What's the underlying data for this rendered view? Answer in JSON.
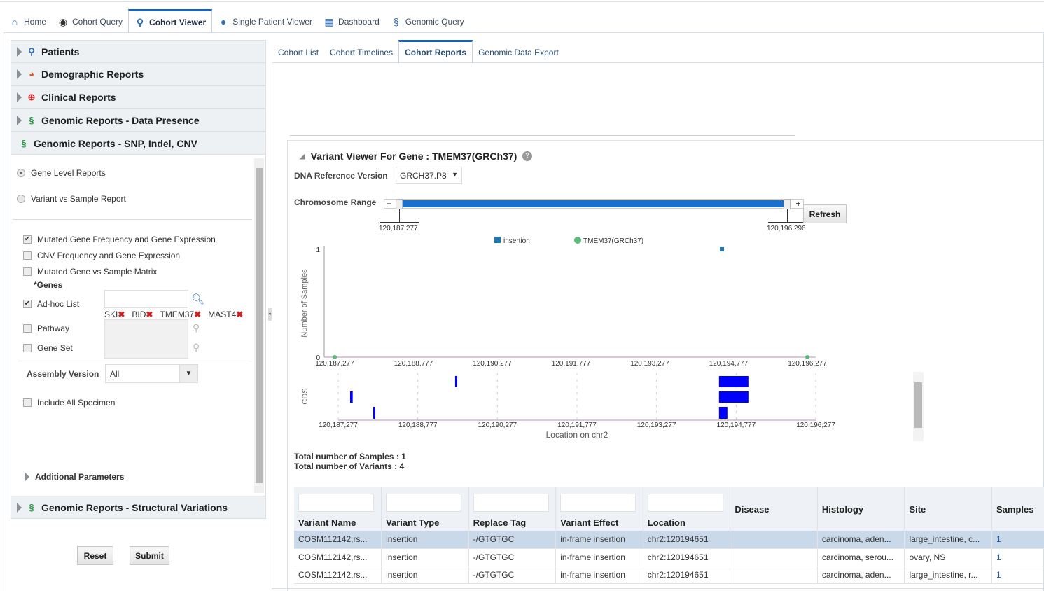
{
  "main_tabs": [
    {
      "label": "Home",
      "icon": "home-icon"
    },
    {
      "label": "Cohort Query",
      "icon": "cohort-query-icon"
    },
    {
      "label": "Cohort Viewer",
      "icon": "cohort-viewer-icon",
      "active": true
    },
    {
      "label": "Single Patient Viewer",
      "icon": "patient-icon"
    },
    {
      "label": "Dashboard",
      "icon": "dashboard-icon"
    },
    {
      "label": "Genomic Query",
      "icon": "genomic-query-icon"
    }
  ],
  "sidebar": {
    "sections": [
      {
        "label": "Patients"
      },
      {
        "label": "Demographic Reports"
      },
      {
        "label": "Clinical Reports"
      },
      {
        "label": "Genomic Reports - Data Presence"
      },
      {
        "label": "Genomic Reports - SNP, Indel, CNV"
      },
      {
        "label": "Genomic Reports - Structural Variations"
      }
    ],
    "report_types": [
      {
        "label": "Gene Level Reports",
        "selected": true
      },
      {
        "label": "Variant vs Sample Report",
        "selected": false
      }
    ],
    "options": [
      {
        "label": "Mutated Gene Frequency and Gene Expression",
        "checked": true
      },
      {
        "label": "CNV Frequency and Gene Expression",
        "checked": false
      },
      {
        "label": "Mutated Gene vs Sample Matrix",
        "checked": false
      }
    ],
    "genes_label": "*Genes",
    "adhoc": {
      "label": "Ad-hoc List",
      "checked": true,
      "genes": [
        "SKI",
        "BID",
        "TMEM37",
        "MAST4"
      ]
    },
    "pathway": {
      "label": "Pathway",
      "checked": false
    },
    "gene_set": {
      "label": "Gene Set",
      "checked": false
    },
    "assembly": {
      "label": "Assembly Version",
      "value": "All"
    },
    "include_all": {
      "label": "Include All Specimen",
      "checked": false
    },
    "additional": "Additional Parameters",
    "reset": "Reset",
    "submit": "Submit"
  },
  "sub_tabs": [
    {
      "label": "Cohort List"
    },
    {
      "label": "Cohort Timelines"
    },
    {
      "label": "Cohort Reports",
      "active": true
    },
    {
      "label": "Genomic Data Export"
    }
  ],
  "viewer": {
    "title": "Variant Viewer For Gene : TMEM37(GRCh37)",
    "dna_ref_label": "DNA Reference Version",
    "dna_ref_value": "GRCH37.P8",
    "range_label": "Chromosome Range",
    "range_min": "120,187,277",
    "range_max": "120,196,296",
    "refresh": "Refresh",
    "total_samples": "Total number of Samples : 1",
    "total_variants": "Total number of Variants : 4"
  },
  "chart_data": [
    {
      "type": "scatter",
      "ylabel": "Number of Samples",
      "xlim": [
        120187277,
        120196277
      ],
      "ylim": [
        0,
        1
      ],
      "xticks": [
        "120,187,277",
        "120,188,777",
        "120,190,277",
        "120,191,777",
        "120,193,277",
        "120,194,777",
        "120,196,277"
      ],
      "yticks": [
        "0",
        "1"
      ],
      "legend": [
        "insertion",
        "TMEM37(GRCh37)"
      ],
      "legend_placement": "top",
      "series": [
        {
          "name": "insertion",
          "color": "#1f77b4",
          "points": [
            [
              120194651,
              1
            ]
          ]
        },
        {
          "name": "TMEM37(GRCh37)",
          "color": "#5cb87a",
          "points": [
            [
              120187277,
              0
            ],
            [
              120196277,
              0
            ]
          ]
        }
      ]
    },
    {
      "type": "bar",
      "ylabel": "CDS",
      "xlabel": "Location on chr2",
      "xlim": [
        120187277,
        120196277
      ],
      "xticks": [
        "120,187,277",
        "120,188,777",
        "120,190,277",
        "120,191,777",
        "120,193,277",
        "120,194,777",
        "120,196,277"
      ],
      "color": "#0000ff",
      "tracks": [
        [
          [
            120189480,
            120189510
          ],
          [
            120194454,
            120195008
          ]
        ],
        [
          [
            120187501,
            120187550
          ],
          [
            120194454,
            120195008
          ]
        ],
        [
          [
            120187937,
            120187970
          ],
          [
            120194454,
            120194612
          ]
        ]
      ]
    }
  ],
  "table": {
    "columns": [
      "Variant Name",
      "Variant Type",
      "Replace Tag",
      "Variant Effect",
      "Location",
      "Disease",
      "Histology",
      "Site",
      "Samples"
    ],
    "rows": [
      [
        "COSM112142,rs...",
        "insertion",
        "-/GTGTGC",
        "in-frame insertion",
        "chr2:120194651",
        "",
        "carcinoma, aden...",
        "large_intestine, c...",
        "1"
      ],
      [
        "COSM112142,rs...",
        "insertion",
        "-/GTGTGC",
        "in-frame insertion",
        "chr2:120194651",
        "",
        "carcinoma, serou...",
        "ovary, NS",
        "1"
      ],
      [
        "COSM112142,rs...",
        "insertion",
        "-/GTGTGC",
        "in-frame insertion",
        "chr2:120194651",
        "",
        "carcinoma, aden...",
        "large_intestine, r...",
        "1"
      ]
    ]
  }
}
